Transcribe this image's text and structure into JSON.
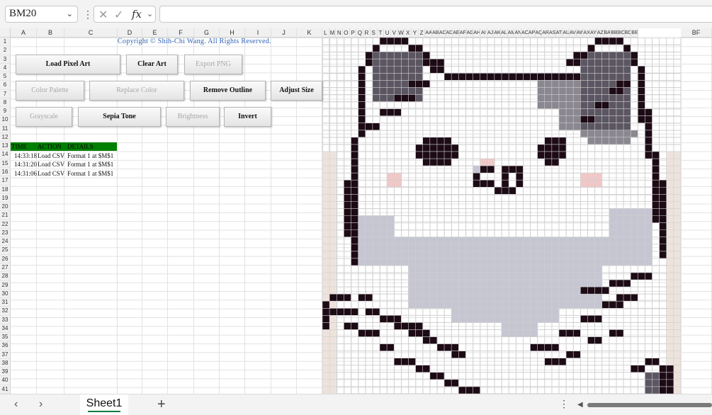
{
  "formula_bar": {
    "name_box": "BM20",
    "cancel_symbol": "✕",
    "enter_symbol": "✓",
    "fx_symbol": "fx",
    "formula": ""
  },
  "columns": [
    "A",
    "B",
    "C",
    "D",
    "E",
    "F",
    "G",
    "H",
    "I",
    "J",
    "K",
    "L",
    "M",
    "N",
    "O",
    "P",
    "Q",
    "R",
    "S",
    "T",
    "U",
    "V",
    "W",
    "X",
    "Y",
    "Z",
    "AA",
    "AB",
    "AC",
    "AD",
    "AE",
    "AF",
    "AG",
    "AH",
    "AI",
    "AJ",
    "AK",
    "AL",
    "AM",
    "AN",
    "AO",
    "AP",
    "AQ",
    "AR",
    "AS",
    "AT",
    "AU",
    "AV",
    "AW",
    "AX",
    "AY",
    "AZ",
    "BA",
    "BB",
    "BC",
    "BD",
    "BE",
    "BF"
  ],
  "rows": [
    "1",
    "2",
    "3",
    "4",
    "5",
    "6",
    "7",
    "8",
    "9",
    "10",
    "11",
    "12",
    "13",
    "14",
    "15",
    "16",
    "17",
    "18",
    "19",
    "20",
    "21",
    "22",
    "23",
    "24",
    "25",
    "26",
    "27",
    "28",
    "29",
    "30",
    "31",
    "32",
    "33",
    "34",
    "35",
    "36",
    "37",
    "38",
    "39",
    "40",
    "41"
  ],
  "copyright": "Copyright © Shih-Chi Wang. All Rights Reserved.",
  "buttons": [
    {
      "label": "Load Pixel Art",
      "enabled": true
    },
    {
      "label": "Clear Art",
      "enabled": true
    },
    {
      "label": "Export PNG",
      "enabled": false
    },
    {
      "label": "Color Palette",
      "enabled": false
    },
    {
      "label": "Replace Color",
      "enabled": false
    },
    {
      "label": "Remove Outline",
      "enabled": true
    },
    {
      "label": "Adjust Size",
      "enabled": true
    },
    {
      "label": "Grayscale",
      "enabled": false
    },
    {
      "label": "Sepia Tone",
      "enabled": true
    },
    {
      "label": "Brightness",
      "enabled": false
    },
    {
      "label": "Invert",
      "enabled": true
    }
  ],
  "log": {
    "headers": [
      "TIME",
      "ACTION",
      "DETAILS"
    ],
    "header_color": "#008000",
    "rows": [
      {
        "time": "14:33:18",
        "action": "Load CSV",
        "details": "Format 1 at $M$1"
      },
      {
        "time": "14:31:20",
        "action": "Load CSV",
        "details": "Format 1 at $M$1"
      },
      {
        "time": "14:31:06",
        "action": "Load CSV",
        "details": "Format 1 at $M$1"
      }
    ]
  },
  "pixel_art": {
    "palette": {
      "k": "#1c0a14",
      "d": "#5b5662",
      "m": "#8a8790",
      "l": "#c5c6d2",
      "p": "#f0c8c8",
      "s": "#ede3dc"
    },
    "columns": 50,
    "rows": 50,
    "rects": [
      [
        0,
        16,
        2,
        34,
        "s"
      ],
      [
        48,
        16,
        2,
        34,
        "s"
      ],
      [
        8,
        0,
        4,
        1,
        "k"
      ],
      [
        38,
        0,
        4,
        1,
        "k"
      ],
      [
        7,
        1,
        1,
        1,
        "k"
      ],
      [
        12,
        1,
        2,
        1,
        "k"
      ],
      [
        37,
        1,
        1,
        1,
        "k"
      ],
      [
        42,
        1,
        1,
        1,
        "k"
      ],
      [
        6,
        2,
        1,
        2,
        "k"
      ],
      [
        14,
        2,
        1,
        2,
        "k"
      ],
      [
        35,
        2,
        2,
        1,
        "k"
      ],
      [
        43,
        2,
        1,
        2,
        "k"
      ],
      [
        7,
        2,
        7,
        1,
        "d"
      ],
      [
        37,
        2,
        6,
        1,
        "d"
      ],
      [
        7,
        3,
        7,
        6,
        "d"
      ],
      [
        36,
        3,
        7,
        10,
        "d"
      ],
      [
        15,
        3,
        2,
        1,
        "k"
      ],
      [
        34,
        3,
        2,
        1,
        "k"
      ],
      [
        5,
        4,
        1,
        10,
        "k"
      ],
      [
        17,
        5,
        17,
        1,
        "k"
      ],
      [
        15,
        4,
        2,
        1,
        "k"
      ],
      [
        44,
        4,
        1,
        8,
        "k"
      ],
      [
        29,
        5,
        7,
        1,
        "k"
      ],
      [
        12,
        6,
        3,
        1,
        "k"
      ],
      [
        10,
        8,
        3,
        1,
        "k"
      ],
      [
        8,
        10,
        3,
        1,
        "k"
      ],
      [
        6,
        12,
        2,
        1,
        "k"
      ],
      [
        41,
        6,
        2,
        1,
        "k"
      ],
      [
        40,
        7,
        2,
        1,
        "k"
      ],
      [
        38,
        9,
        2,
        1,
        "k"
      ],
      [
        36,
        11,
        2,
        1,
        "k"
      ],
      [
        30,
        6,
        6,
        4,
        "m"
      ],
      [
        33,
        10,
        3,
        3,
        "m"
      ],
      [
        36,
        13,
        8,
        1,
        "m"
      ],
      [
        37,
        14,
        6,
        1,
        "m"
      ],
      [
        45,
        10,
        1,
        7,
        "k"
      ],
      [
        4,
        14,
        1,
        18,
        "k"
      ],
      [
        3,
        20,
        1,
        8,
        "k"
      ],
      [
        46,
        16,
        1,
        10,
        "k"
      ],
      [
        47,
        20,
        1,
        11,
        "k"
      ],
      [
        4,
        17,
        1,
        1,
        "k"
      ],
      [
        14,
        14,
        4,
        1,
        "k"
      ],
      [
        13,
        15,
        6,
        2,
        "k"
      ],
      [
        14,
        17,
        4,
        1,
        "k"
      ],
      [
        31,
        14,
        3,
        1,
        "k"
      ],
      [
        30,
        15,
        4,
        2,
        "k"
      ],
      [
        31,
        17,
        2,
        1,
        "k"
      ],
      [
        22,
        17,
        2,
        1,
        "p"
      ],
      [
        21,
        18,
        2,
        1,
        "l"
      ],
      [
        22,
        18,
        2,
        1,
        "k"
      ],
      [
        25,
        18,
        3,
        1,
        "k"
      ],
      [
        21,
        19,
        1,
        2,
        "k"
      ],
      [
        25,
        19,
        1,
        2,
        "k"
      ],
      [
        27,
        19,
        1,
        2,
        "k"
      ],
      [
        22,
        20,
        2,
        1,
        "k"
      ],
      [
        24,
        21,
        2,
        1,
        "k"
      ],
      [
        26,
        21,
        1,
        1,
        "k"
      ],
      [
        9,
        19,
        2,
        2,
        "p"
      ],
      [
        36,
        19,
        3,
        2,
        "p"
      ],
      [
        5,
        25,
        5,
        7,
        "l"
      ],
      [
        40,
        24,
        6,
        8,
        "l"
      ],
      [
        10,
        28,
        30,
        4,
        "l"
      ],
      [
        12,
        32,
        27,
        6,
        "l"
      ],
      [
        18,
        38,
        15,
        2,
        "l"
      ],
      [
        25,
        40,
        5,
        2,
        "l"
      ],
      [
        0,
        37,
        1,
        4,
        "k"
      ],
      [
        1,
        36,
        3,
        1,
        "k"
      ],
      [
        1,
        38,
        4,
        1,
        "k"
      ],
      [
        5,
        36,
        2,
        1,
        "k"
      ],
      [
        3,
        40,
        2,
        1,
        "k"
      ],
      [
        6,
        38,
        2,
        1,
        "k"
      ],
      [
        8,
        39,
        3,
        1,
        "k"
      ],
      [
        10,
        40,
        4,
        1,
        "k"
      ],
      [
        12,
        41,
        3,
        1,
        "k"
      ],
      [
        14,
        42,
        2,
        1,
        "k"
      ],
      [
        5,
        41,
        3,
        1,
        "k"
      ],
      [
        8,
        43,
        2,
        1,
        "k"
      ],
      [
        10,
        45,
        3,
        1,
        "k"
      ],
      [
        13,
        46,
        2,
        1,
        "k"
      ],
      [
        15,
        47,
        2,
        1,
        "k"
      ],
      [
        17,
        48,
        2,
        1,
        "k"
      ],
      [
        19,
        49,
        3,
        1,
        "k"
      ],
      [
        16,
        43,
        3,
        1,
        "k"
      ],
      [
        18,
        44,
        2,
        1,
        "k"
      ],
      [
        36,
        35,
        4,
        1,
        "k"
      ],
      [
        40,
        34,
        3,
        1,
        "k"
      ],
      [
        43,
        33,
        3,
        1,
        "k"
      ],
      [
        41,
        36,
        3,
        1,
        "k"
      ],
      [
        29,
        43,
        4,
        1,
        "k"
      ],
      [
        33,
        41,
        3,
        1,
        "k"
      ],
      [
        36,
        39,
        3,
        1,
        "k"
      ],
      [
        39,
        37,
        3,
        1,
        "k"
      ],
      [
        31,
        45,
        3,
        1,
        "k"
      ],
      [
        34,
        44,
        2,
        1,
        "k"
      ],
      [
        37,
        42,
        2,
        1,
        "k"
      ],
      [
        40,
        41,
        2,
        1,
        "k"
      ],
      [
        45,
        45,
        2,
        1,
        "k"
      ],
      [
        43,
        46,
        2,
        1,
        "k"
      ],
      [
        47,
        46,
        2,
        4,
        "k"
      ],
      [
        45,
        47,
        2,
        3,
        "d"
      ]
    ]
  }
}
